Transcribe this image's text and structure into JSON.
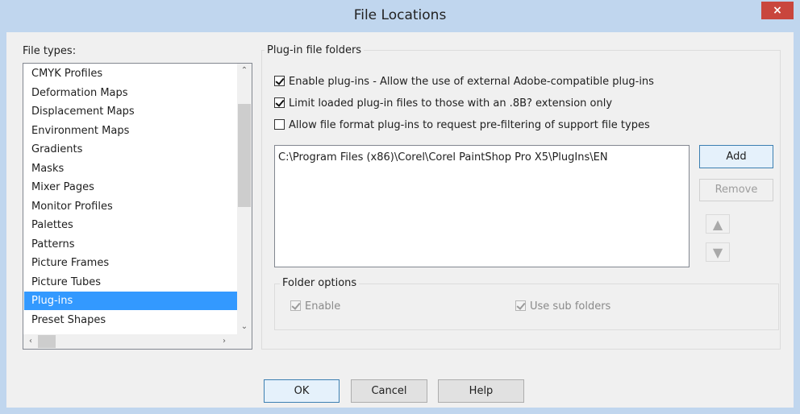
{
  "window": {
    "title": "File Locations",
    "close_glyph": "×"
  },
  "file_types": {
    "label": "File types:",
    "items": [
      "CMYK Profiles",
      "Deformation Maps",
      "Displacement Maps",
      "Environment Maps",
      "Gradients",
      "Masks",
      "Mixer Pages",
      "Monitor Profiles",
      "Palettes",
      "Patterns",
      "Picture Frames",
      "Picture Tubes",
      "Plug-ins",
      "Preset Shapes"
    ],
    "selected_index": 12
  },
  "plugin_group": {
    "label": "Plug-in file folders",
    "options": [
      {
        "label": "Enable plug-ins - Allow the use of external Adobe-compatible plug-ins",
        "checked": true
      },
      {
        "label": "Limit loaded plug-in files to those with an .8B? extension only",
        "checked": true
      },
      {
        "label": "Allow file format plug-ins to request pre-filtering of support file types",
        "checked": false
      }
    ],
    "folders": [
      "C:\\Program Files (x86)\\Corel\\Corel PaintShop Pro X5\\PlugIns\\EN"
    ],
    "add_label": "Add",
    "remove_label": "Remove"
  },
  "folder_options": {
    "label": "Folder options",
    "enable_label": "Enable",
    "enable_checked": true,
    "subfolders_label": "Use sub folders",
    "subfolders_checked": true
  },
  "footer": {
    "ok_label": "OK",
    "cancel_label": "Cancel",
    "help_label": "Help"
  },
  "colors": {
    "titlebar": "#c0d6ee",
    "selection": "#3399ff",
    "close": "#c9463d"
  }
}
